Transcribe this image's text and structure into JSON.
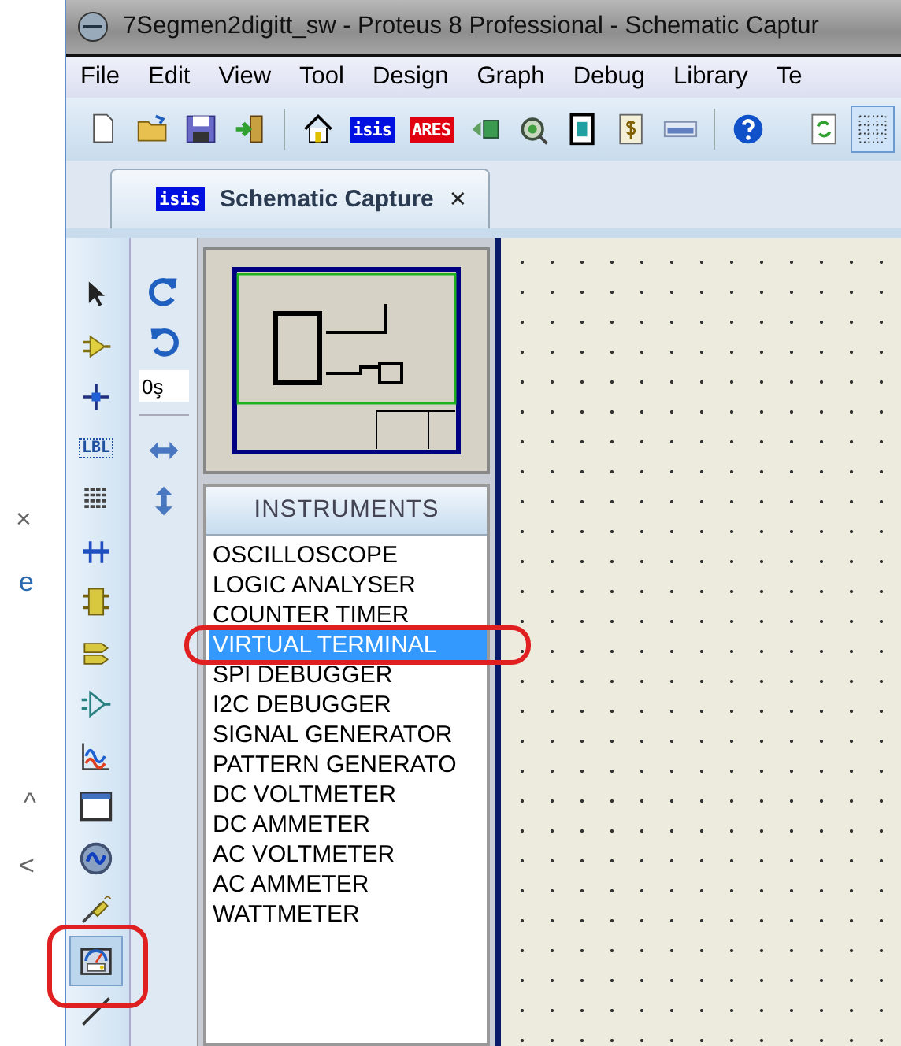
{
  "window": {
    "title": "7Segmen2digitt_sw - Proteus 8 Professional - Schematic Captur"
  },
  "menu": [
    "File",
    "Edit",
    "View",
    "Tool",
    "Design",
    "Graph",
    "Debug",
    "Library",
    "Te"
  ],
  "toolbar": [
    {
      "kind": "new"
    },
    {
      "kind": "open"
    },
    {
      "kind": "save"
    },
    {
      "kind": "import"
    },
    {
      "kind": "sep"
    },
    {
      "kind": "home"
    },
    {
      "kind": "logo",
      "text": "isis",
      "color": "#0010e0"
    },
    {
      "kind": "logo",
      "text": "ARES",
      "color": "#e00010"
    },
    {
      "kind": "back"
    },
    {
      "kind": "wheel"
    },
    {
      "kind": "board"
    },
    {
      "kind": "bom"
    },
    {
      "kind": "bar"
    },
    {
      "kind": "sep"
    },
    {
      "kind": "help"
    },
    {
      "kind": "gap"
    },
    {
      "kind": "refresh"
    },
    {
      "kind": "grid",
      "selected": true
    }
  ],
  "tab": {
    "logo": "isis",
    "label": "Schematic Capture",
    "close": "×"
  },
  "background_window": {
    "glyphs": [
      "×",
      "e",
      "^",
      "<"
    ]
  },
  "tools": [
    {
      "kind": "pointer",
      "selected": false
    },
    {
      "kind": "component",
      "selected": false
    },
    {
      "kind": "junction",
      "selected": false
    },
    {
      "kind": "label",
      "text": "LBL",
      "selected": false
    },
    {
      "kind": "text",
      "selected": false
    },
    {
      "kind": "bus",
      "selected": false
    },
    {
      "kind": "subcircuit",
      "selected": false
    },
    {
      "kind": "terminal",
      "selected": false
    },
    {
      "kind": "port",
      "selected": false
    },
    {
      "kind": "graph",
      "selected": false
    },
    {
      "kind": "window",
      "selected": false
    },
    {
      "kind": "generator",
      "selected": false
    },
    {
      "kind": "probe",
      "selected": false
    },
    {
      "kind": "instrument",
      "selected": true,
      "circled": true
    },
    {
      "kind": "line",
      "selected": false
    }
  ],
  "orientation": {
    "angle": "0ş"
  },
  "picker": {
    "title": "INSTRUMENTS",
    "items": [
      {
        "label": "OSCILLOSCOPE",
        "selected": false,
        "circled": false
      },
      {
        "label": "LOGIC ANALYSER",
        "selected": false,
        "circled": false
      },
      {
        "label": "COUNTER TIMER",
        "selected": false,
        "circled": false
      },
      {
        "label": "VIRTUAL TERMINAL",
        "selected": true,
        "circled": true
      },
      {
        "label": "SPI DEBUGGER",
        "selected": false,
        "circled": false
      },
      {
        "label": "I2C DEBUGGER",
        "selected": false,
        "circled": false
      },
      {
        "label": "SIGNAL GENERATOR",
        "selected": false,
        "circled": false
      },
      {
        "label": "PATTERN GENERATO",
        "selected": false,
        "circled": false
      },
      {
        "label": "DC VOLTMETER",
        "selected": false,
        "circled": false
      },
      {
        "label": "DC AMMETER",
        "selected": false,
        "circled": false
      },
      {
        "label": "AC VOLTMETER",
        "selected": false,
        "circled": false
      },
      {
        "label": "AC AMMETER",
        "selected": false,
        "circled": false
      },
      {
        "label": "WATTMETER",
        "selected": false,
        "circled": false
      }
    ]
  }
}
